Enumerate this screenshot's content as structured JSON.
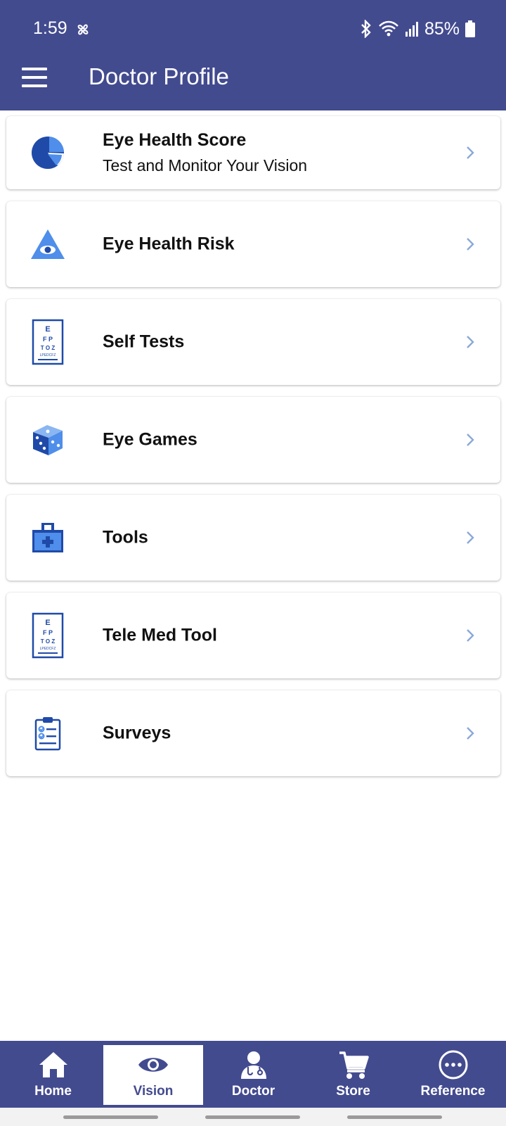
{
  "status_bar": {
    "time": "1:59",
    "battery": "85%",
    "icons": [
      "fan-icon",
      "bluetooth-icon",
      "wifi-icon",
      "signal-icon",
      "battery-icon"
    ]
  },
  "app_bar": {
    "title": "Doctor Profile",
    "menu_icon": "hamburger-menu-icon"
  },
  "menu": {
    "items": [
      {
        "title": "Eye Health Score",
        "subtitle": "Test and Monitor Your Vision",
        "icon": "pie-chart-icon"
      },
      {
        "title": "Eye Health Risk",
        "icon": "eye-triangle-icon"
      },
      {
        "title": "Self Tests",
        "icon": "eye-chart-icon"
      },
      {
        "title": "Eye Games",
        "icon": "dice-icon"
      },
      {
        "title": "Tools",
        "icon": "medical-kit-icon"
      },
      {
        "title": "Tele Med Tool",
        "icon": "eye-chart-icon"
      },
      {
        "title": "Surveys",
        "icon": "clipboard-checklist-icon"
      }
    ],
    "chevron_icon": "chevron-right-icon"
  },
  "bottom_nav": {
    "items": [
      {
        "label": "Home",
        "icon": "home-icon"
      },
      {
        "label": "Vision",
        "icon": "eye-icon"
      },
      {
        "label": "Doctor",
        "icon": "doctor-icon"
      },
      {
        "label": "Store",
        "icon": "cart-icon"
      },
      {
        "label": "Reference",
        "icon": "more-icon"
      }
    ],
    "active": "Vision"
  },
  "colors": {
    "primary": "#434b8f",
    "icon_blue": "#1f4aa8",
    "icon_light_blue": "#4f8eea",
    "chevron": "#8aa9d9",
    "background": "#ffffff"
  }
}
